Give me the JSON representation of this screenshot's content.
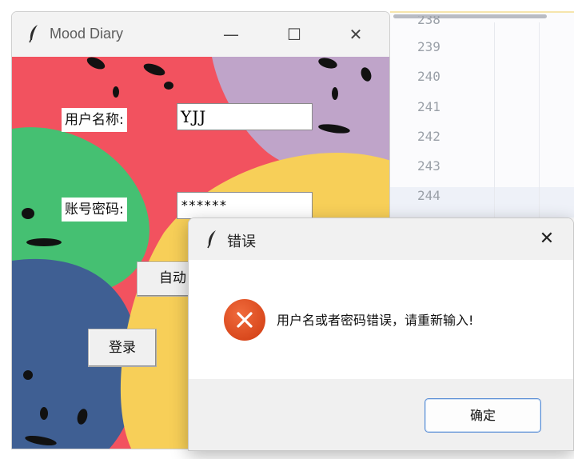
{
  "editor": {
    "line_numbers": [
      "238",
      "239",
      "240",
      "241",
      "242",
      "243",
      "244"
    ]
  },
  "app_window": {
    "title": "Mood Diary",
    "controls": {
      "minimize": "—",
      "maximize": "☐",
      "close": "✕"
    },
    "username_label": "用户名称:",
    "username_value": "YJJ",
    "password_label": "账号密码:",
    "password_value": "******",
    "auto_button_label": "自动",
    "login_button_label": "登录"
  },
  "dialog": {
    "title": "错误",
    "close": "✕",
    "icon": "error-x-icon",
    "message": "用户名或者密码错误，请重新输入!",
    "ok_label": "确定"
  },
  "colors": {
    "blob_red": "#f2525f",
    "blob_lavender": "#bfa4c9",
    "blob_green": "#45c072",
    "blob_blue": "#3f5f93",
    "blob_yellow": "#f7cf58",
    "error_red": "#d9461a",
    "accent_blue": "#5b8fd6"
  }
}
